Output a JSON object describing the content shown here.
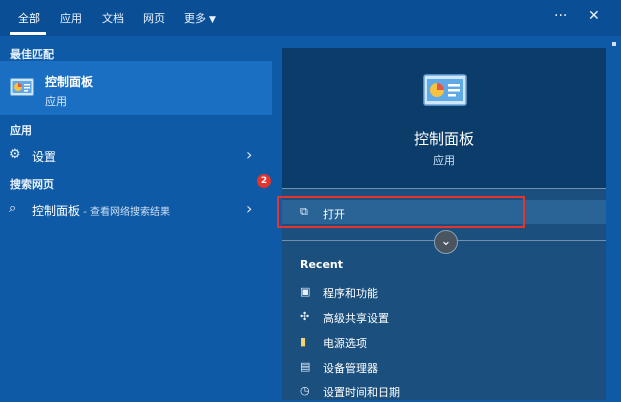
{
  "tabs": [
    {
      "label": "全部"
    },
    {
      "label": "应用"
    },
    {
      "label": "文档"
    },
    {
      "label": "网页"
    },
    {
      "label": "更多"
    }
  ],
  "top_icons": {
    "more_options": "···",
    "close": "✕"
  },
  "left": {
    "best_match_label": "最佳匹配",
    "best_match": {
      "title": "控制面板",
      "subtitle": "应用"
    },
    "apps_label": "应用",
    "settings_item": "设置",
    "web_label": "搜索网页",
    "web_badge": "2",
    "web_item": {
      "title": "控制面板",
      "suffix": " - 查看网络搜索结果"
    }
  },
  "right": {
    "title": "控制面板",
    "subtitle": "应用",
    "open_label": "打开",
    "recent_label": "Recent",
    "recent_items": [
      "程序和功能",
      "高级共享设置",
      "电源选项",
      "设备管理器",
      "设置时间和日期"
    ]
  },
  "colors": {
    "accent": "#0e5aa6",
    "highlight": "#e3342f",
    "badge": "#e3342f"
  }
}
